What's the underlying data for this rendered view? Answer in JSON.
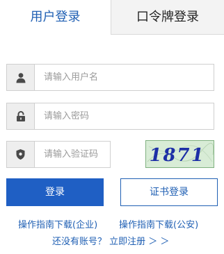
{
  "tabs": {
    "user_login": "用户登录",
    "token_login": "口令牌登录"
  },
  "form": {
    "username_placeholder": "请输入用户名",
    "password_placeholder": "请输入密码",
    "captcha_placeholder": "请输入验证码",
    "captcha_text": "1871"
  },
  "buttons": {
    "login": "登录",
    "cert_login": "证书登录"
  },
  "links": {
    "guide_enterprise": "操作指南下载(企业)",
    "guide_public": "操作指南下载(公安)",
    "register": "还没有账号？ 立即注册 ＞ ＞"
  },
  "icons": {
    "username": "user-icon",
    "password": "lock-icon",
    "captcha": "shield-icon"
  },
  "colors": {
    "accent": "#1f5fc4",
    "link": "#1f5fb3",
    "inactive_tab_bg": "#f3f3f3"
  }
}
